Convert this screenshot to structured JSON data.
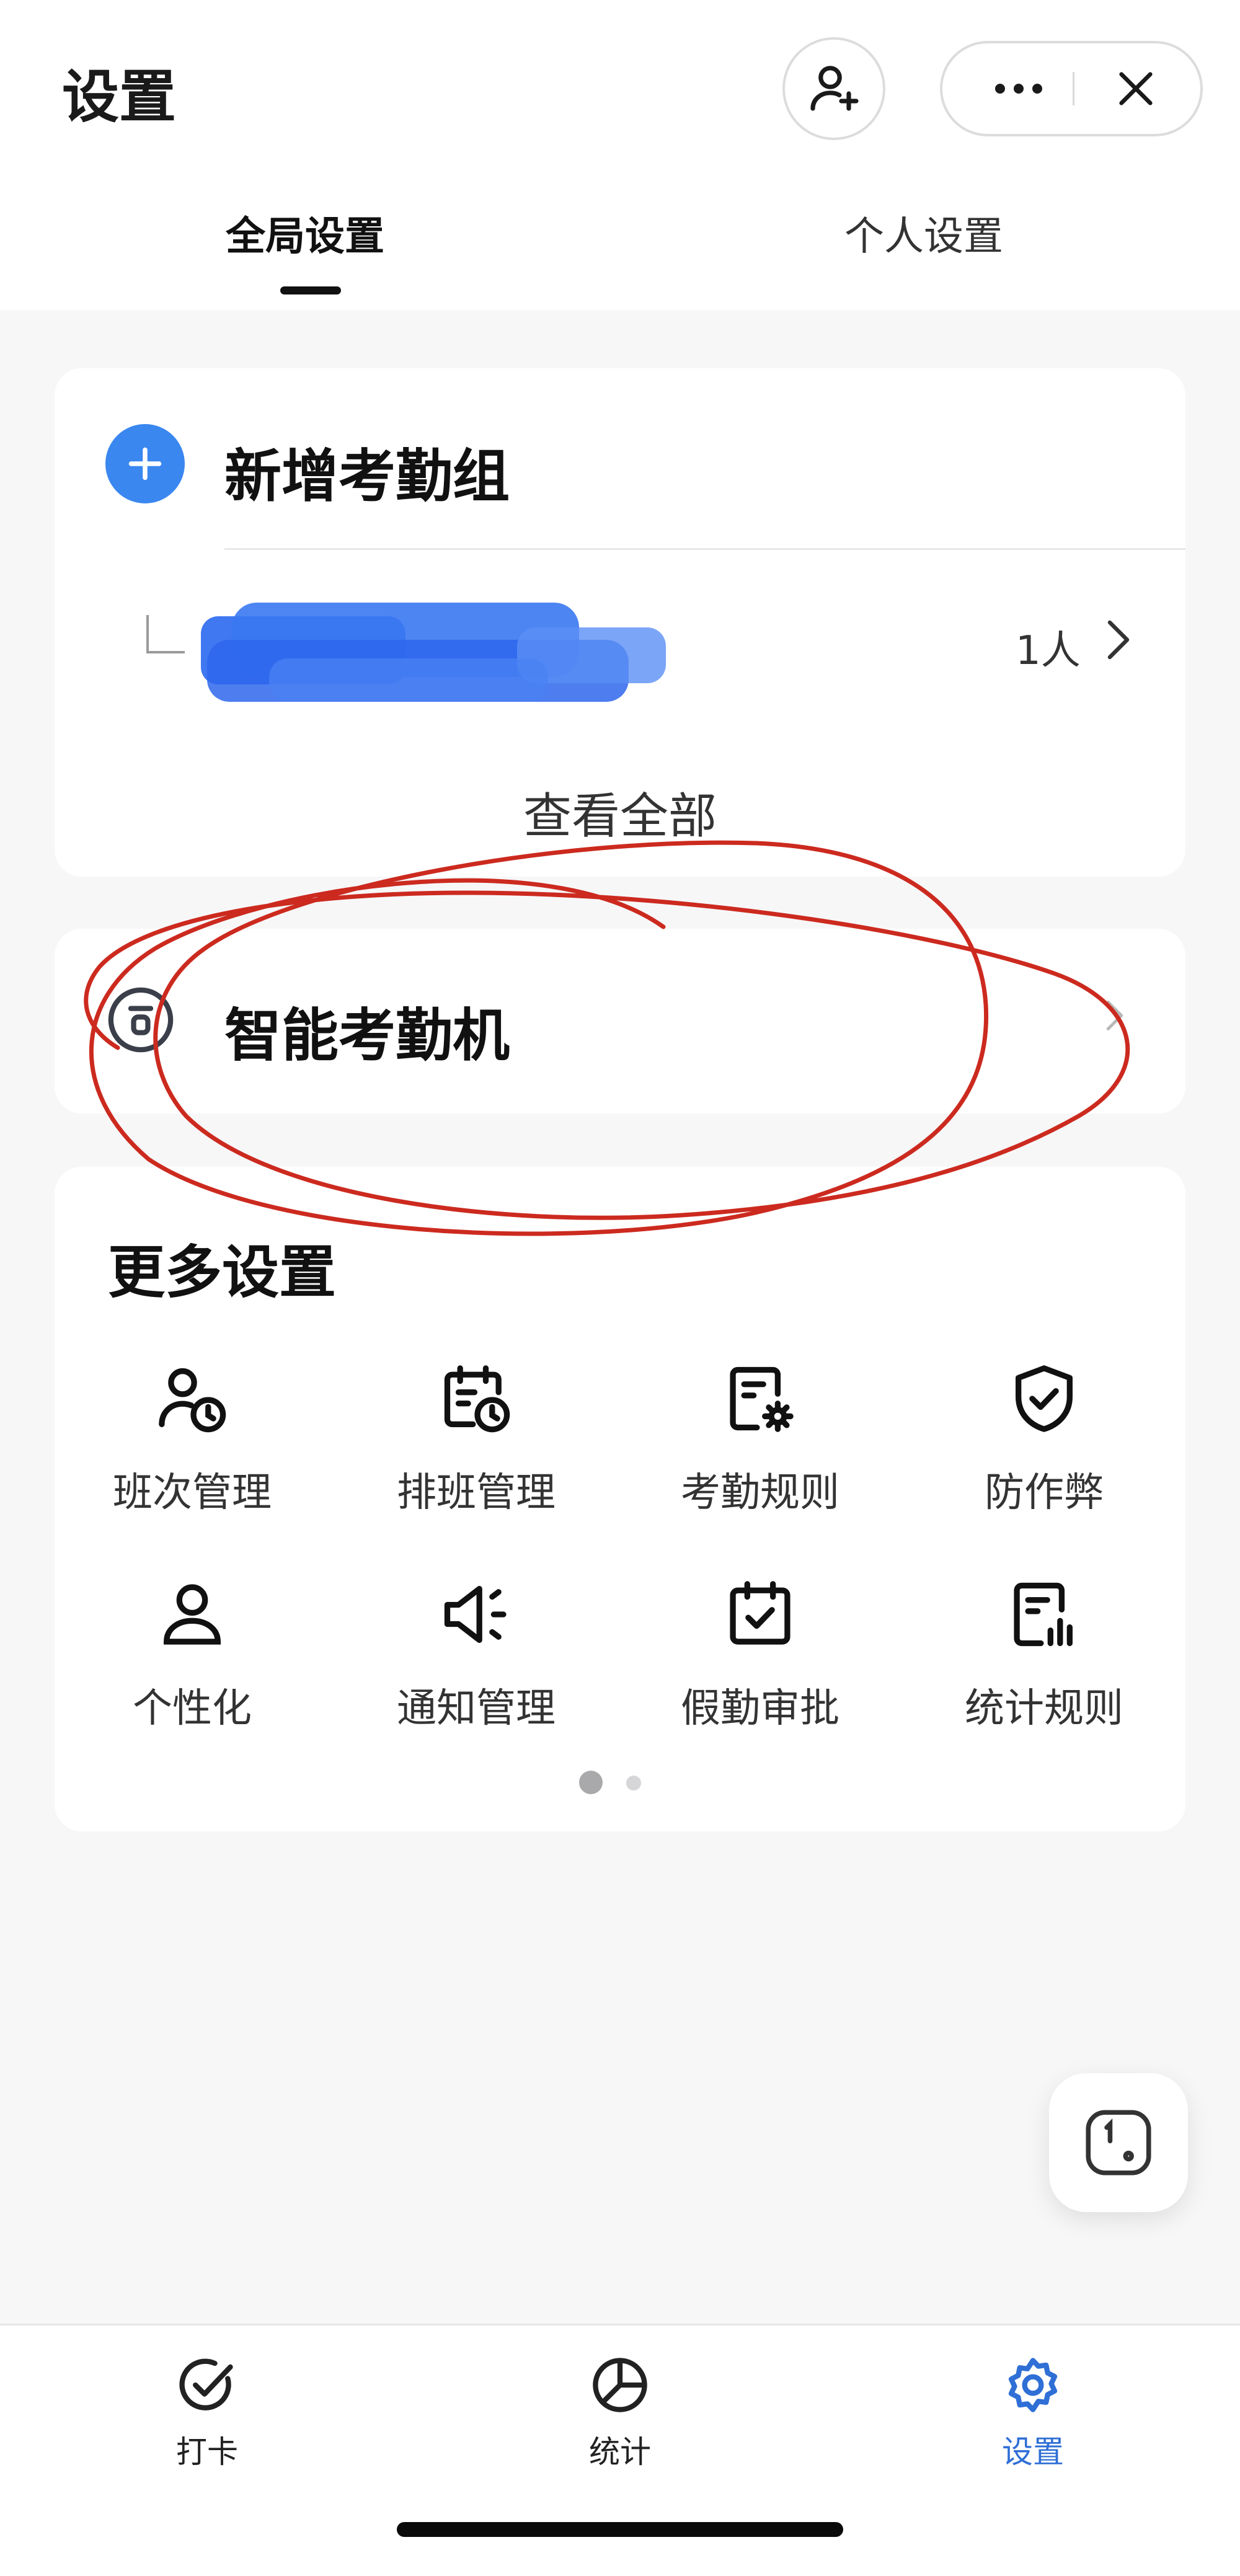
{
  "header": {
    "title": "设置",
    "icons": {
      "add_user": "add-user-icon",
      "more": "more-icon",
      "close": "close-icon"
    }
  },
  "tabs": [
    {
      "label": "全局设置",
      "active": true
    },
    {
      "label": "个人设置",
      "active": false
    }
  ],
  "attendance_groups": {
    "add_label": "新增考勤组",
    "group": {
      "count": "1人"
    },
    "view_all": "查看全部"
  },
  "device": {
    "label": "智能考勤机",
    "icon": "device-icon"
  },
  "more_settings": {
    "title": "更多设置",
    "items": [
      {
        "label": "班次管理",
        "icon": "shift-management-icon"
      },
      {
        "label": "排班管理",
        "icon": "schedule-management-icon"
      },
      {
        "label": "考勤规则",
        "icon": "attendance-rules-icon"
      },
      {
        "label": "防作弊",
        "icon": "anti-cheat-icon"
      },
      {
        "label": "个性化",
        "icon": "personalization-icon"
      },
      {
        "label": "通知管理",
        "icon": "notification-management-icon"
      },
      {
        "label": "假勤审批",
        "icon": "leave-approval-icon"
      },
      {
        "label": "统计规则",
        "icon": "statistics-rules-icon"
      }
    ],
    "pagination": {
      "current": 1,
      "total": 2
    }
  },
  "tabbar": [
    {
      "label": "打卡",
      "icon": "check-in-icon",
      "active": false
    },
    {
      "label": "统计",
      "icon": "statistics-icon",
      "active": false
    },
    {
      "label": "设置",
      "icon": "settings-icon",
      "active": true
    }
  ],
  "colors": {
    "accent": "#3a87f0",
    "active_tab": "#2f6fd6",
    "annotation": "#cc2a1f"
  }
}
